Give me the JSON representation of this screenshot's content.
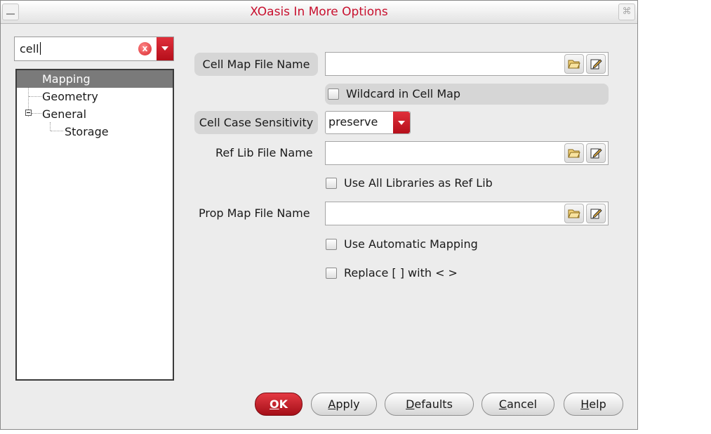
{
  "window": {
    "title": "XOasis In More Options",
    "close_glyph": "⌘"
  },
  "search": {
    "value": "cell",
    "clear_glyph": "x"
  },
  "tree": {
    "items": [
      "Mapping",
      "Geometry",
      "General",
      "Storage"
    ]
  },
  "fields": {
    "cell_map": {
      "label": "Cell Map File Name",
      "value": ""
    },
    "wildcard": {
      "label": "Wildcard in Cell Map",
      "checked": false
    },
    "case": {
      "label": "Cell Case Sensitivity",
      "value": "preserve"
    },
    "ref_lib": {
      "label": "Ref Lib File Name",
      "value": ""
    },
    "use_all": {
      "label": "Use All Libraries as Ref Lib",
      "checked": false
    },
    "prop_map": {
      "label": "Prop Map File Name",
      "value": ""
    },
    "auto_map": {
      "label": "Use Automatic Mapping",
      "checked": false
    },
    "replace": {
      "label": "Replace [ ] with < >",
      "checked": false
    }
  },
  "buttons": {
    "ok": {
      "u": "O",
      "rest": "K"
    },
    "apply": {
      "u": "A",
      "rest": "pply"
    },
    "defaults": {
      "u": "D",
      "rest": "efaults"
    },
    "cancel": {
      "u": "C",
      "rest": "ancel"
    },
    "help": {
      "u": "H",
      "rest": "elp"
    }
  },
  "colors": {
    "title": "#c8102e",
    "accent": "#c8102e",
    "selection": "#7a7a7a"
  }
}
